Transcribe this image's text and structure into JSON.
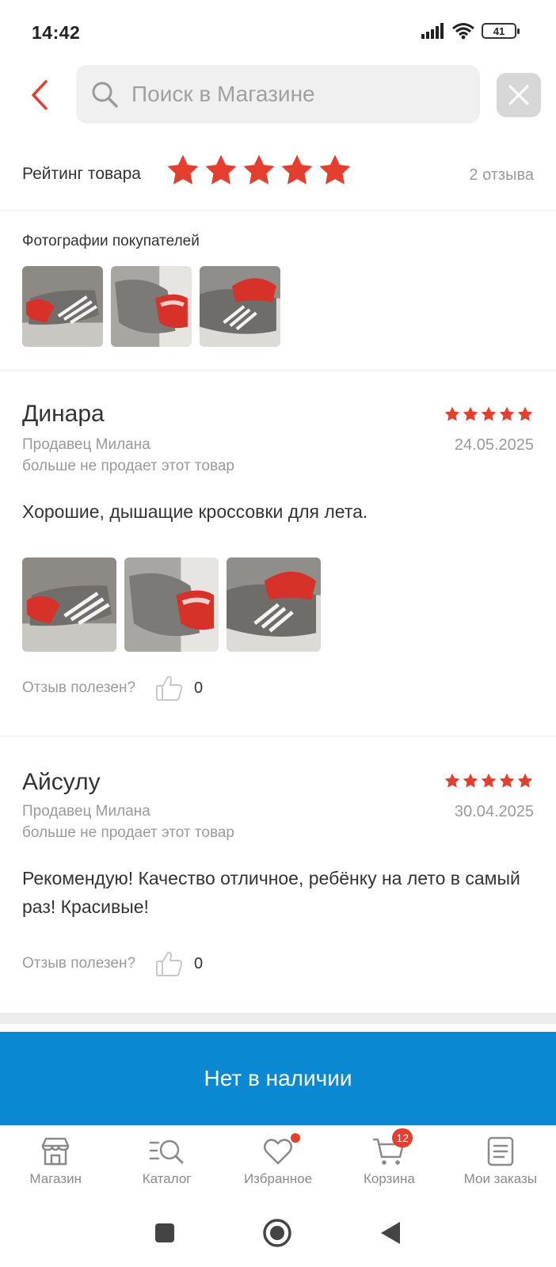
{
  "status_bar": {
    "time": "14:42",
    "battery": "41"
  },
  "search": {
    "placeholder": "Поиск в Магазине"
  },
  "rating": {
    "label": "Рейтинг товара",
    "stars": 5,
    "count_text": "2 отзыва"
  },
  "customer_photos": {
    "title": "Фотографии покупателей",
    "count": 3
  },
  "reviews": [
    {
      "name": "Динара",
      "stars": 5,
      "seller": "Продавец Милана",
      "seller_note": "больше не продает этот товар",
      "date": "24.05.2025",
      "text": "Хорошие, дышащие кроссовки для лета.",
      "photo_count": 3,
      "helpful_label": "Отзыв полезен?",
      "likes": "0"
    },
    {
      "name": "Айсулу",
      "stars": 5,
      "seller": "Продавец Милана",
      "seller_note": "больше не продает этот товар",
      "date": "30.04.2025",
      "text": "Рекомендую! Качество отличное, ребёнку на лето в самый раз! Красивые!",
      "photo_count": 0,
      "helpful_label": "Отзыв полезен?",
      "likes": "0"
    }
  ],
  "out_of_stock_button": "Нет в наличии",
  "bottom_nav": [
    {
      "label": "Магазин",
      "icon": "store-icon"
    },
    {
      "label": "Каталог",
      "icon": "catalog-search-icon"
    },
    {
      "label": "Избранное",
      "icon": "heart-icon",
      "dot": true
    },
    {
      "label": "Корзина",
      "icon": "cart-icon",
      "badge": "12"
    },
    {
      "label": "Мои заказы",
      "icon": "orders-icon"
    }
  ],
  "colors": {
    "accent_red": "#e43e2e",
    "button_blue": "#0a88d2",
    "muted_text": "#9a9a9a"
  }
}
